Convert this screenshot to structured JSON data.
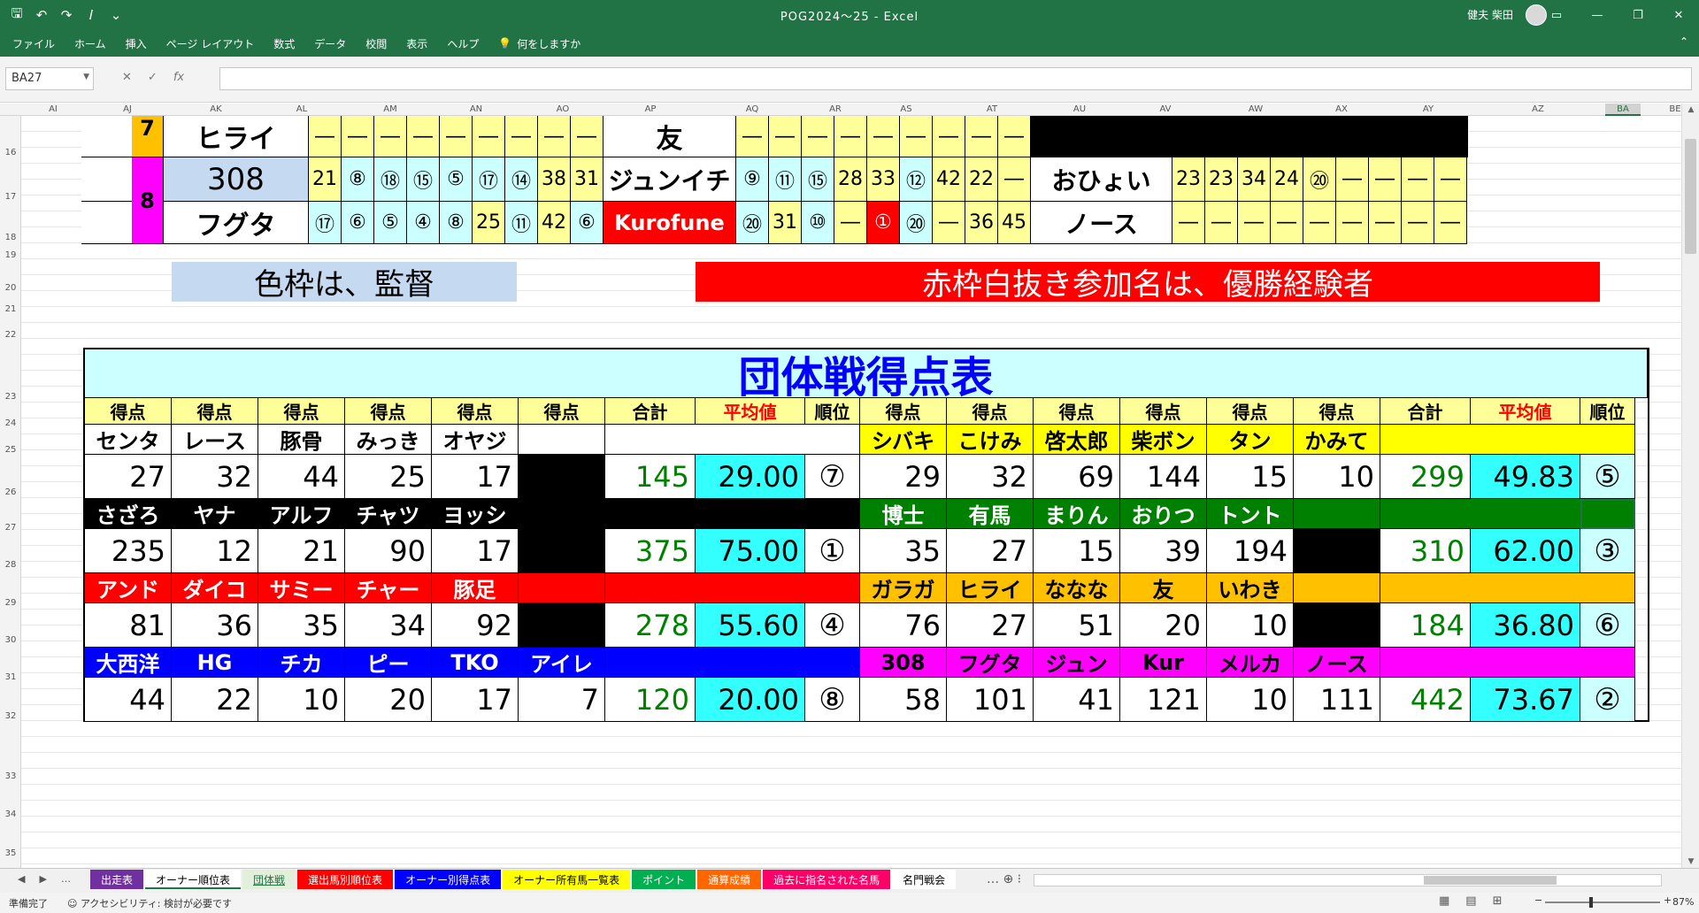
{
  "window": {
    "title": "POG2024～25 - Excel",
    "user": "健夫 柴田",
    "name_box": "BA27"
  },
  "ribbon_tabs": [
    "ファイル",
    "ホーム",
    "挿入",
    "ページ レイアウト",
    "数式",
    "データ",
    "校閲",
    "表示",
    "ヘルプ"
  ],
  "tell_me": "何をしますか",
  "columns": [
    "AI",
    "AJ",
    "AK",
    "AL",
    "AM",
    "AN",
    "AO",
    "AP",
    "AQ",
    "AR",
    "AS",
    "AT",
    "AU",
    "AV",
    "AW",
    "AX",
    "AY",
    "AZ",
    "BA",
    "BE"
  ],
  "rows": [
    "16",
    "17",
    "18",
    "19",
    "20",
    "21",
    "22",
    "23",
    "24",
    "25",
    "26",
    "27",
    "28",
    "29",
    "30",
    "31",
    "32",
    "33",
    "34",
    "35"
  ],
  "top_block": {
    "row16": {
      "group": "7",
      "owner1": "ヒライ",
      "owner1_scores": [
        "―",
        "―",
        "―",
        "―",
        "―",
        "―",
        "―",
        "―",
        "―"
      ],
      "owner2": "友",
      "owner2_scores": [
        "―",
        "―",
        "―",
        "―",
        "―",
        "―",
        "―",
        "―",
        "―"
      ]
    },
    "row17": {
      "group": "8",
      "owner1": "308",
      "owner1_scores": [
        "21",
        "⑧",
        "⑱",
        "⑮",
        "⑤",
        "⑰",
        "⑭",
        "38",
        "31"
      ],
      "owner2": "ジュンイチ",
      "owner2_scores": [
        "⑨",
        "⑪",
        "⑮",
        "28",
        "33",
        "⑫",
        "42",
        "22",
        "―"
      ],
      "owner3": "おひょい",
      "owner3_scores": [
        "23",
        "23",
        "34",
        "24",
        "⑳",
        "―",
        "―",
        "―",
        "―"
      ]
    },
    "row18": {
      "owner1": "フグタ",
      "owner1_scores": [
        "⑰",
        "⑥",
        "⑤",
        "④",
        "⑧",
        "25",
        "⑪",
        "42",
        "⑥"
      ],
      "owner2": "Kurofune",
      "owner2_scores": [
        "⑳",
        "31",
        "⑩",
        "―",
        "①",
        "⑳",
        "―",
        "36",
        "45"
      ],
      "owner3": "ノース",
      "owner3_scores": [
        "―",
        "―",
        "―",
        "―",
        "―",
        "―",
        "―",
        "―",
        "―"
      ]
    }
  },
  "notes": {
    "left": "色枠は、監督",
    "right": "赤枠白抜き参加名は、優勝経験者"
  },
  "team_table": {
    "title": "団体戦得点表",
    "header": {
      "score": "得点",
      "total": "合計",
      "average": "平均値",
      "rank": "順位"
    },
    "teams": [
      {
        "left": {
          "names": [
            "センタ",
            "レース",
            "豚骨",
            "みっき",
            "オヤジ",
            ""
          ],
          "scores": [
            "27",
            "32",
            "44",
            "25",
            "17",
            ""
          ],
          "total": "145",
          "avg": "29.00",
          "rank": "⑦"
        },
        "right": {
          "names": [
            "シバキ",
            "こけみ",
            "啓太郎",
            "柴ボン",
            "タン",
            "かみて"
          ],
          "scores": [
            "29",
            "32",
            "69",
            "144",
            "15",
            "10"
          ],
          "total": "299",
          "avg": "49.83",
          "rank": "⑤"
        }
      },
      {
        "left": {
          "names": [
            "さざろ",
            "ヤナ",
            "アルフ",
            "チャツ",
            "ヨッシ",
            ""
          ],
          "scores": [
            "235",
            "12",
            "21",
            "90",
            "17",
            ""
          ],
          "total": "375",
          "avg": "75.00",
          "rank": "①"
        },
        "right": {
          "names": [
            "博士",
            "有馬",
            "まりん",
            "おりつ",
            "トント",
            ""
          ],
          "scores": [
            "35",
            "27",
            "15",
            "39",
            "194",
            ""
          ],
          "total": "310",
          "avg": "62.00",
          "rank": "③"
        }
      },
      {
        "left": {
          "names": [
            "アンド",
            "ダイコ",
            "サミー",
            "チャー",
            "豚足",
            ""
          ],
          "scores": [
            "81",
            "36",
            "35",
            "34",
            "92",
            ""
          ],
          "total": "278",
          "avg": "55.60",
          "rank": "④"
        },
        "right": {
          "names": [
            "ガラガ",
            "ヒライ",
            "ななな",
            "友",
            "いわき",
            ""
          ],
          "scores": [
            "76",
            "27",
            "51",
            "20",
            "10",
            ""
          ],
          "total": "184",
          "avg": "36.80",
          "rank": "⑥"
        }
      },
      {
        "left": {
          "names": [
            "大西洋",
            "HG",
            "チカ",
            "ピー",
            "TKO",
            "アイレ"
          ],
          "scores": [
            "44",
            "22",
            "10",
            "20",
            "17",
            "7"
          ],
          "total": "120",
          "avg": "20.00",
          "rank": "⑧"
        },
        "right": {
          "names": [
            "308",
            "フグタ",
            "ジュン",
            "Kur",
            "メルカ",
            "ノース"
          ],
          "scores": [
            "58",
            "101",
            "41",
            "121",
            "10",
            "111"
          ],
          "total": "442",
          "avg": "73.67",
          "rank": "②"
        }
      }
    ]
  },
  "sheet_tabs": [
    {
      "label": "出走表",
      "color": "#7030a0"
    },
    {
      "label": "オーナー順位表",
      "color": "#ffffff",
      "active": true
    },
    {
      "label": "団体戦",
      "color": "#00b050"
    },
    {
      "label": "選出馬別順位表",
      "color": "#ff0000"
    },
    {
      "label": "オーナー別得点表",
      "color": "#0000ff"
    },
    {
      "label": "オーナー所有馬一覧表",
      "color": "#ffff00"
    },
    {
      "label": "ポイント",
      "color": "#00b050"
    },
    {
      "label": "通算成績",
      "color": "#ff6600"
    },
    {
      "label": "過去に指名された名馬",
      "color": "#ff0066"
    },
    {
      "label": "名門戦会",
      "color": "#ffffff"
    }
  ],
  "status": {
    "ready": "準備完了",
    "accessibility": "アクセシビリティ: 検討が必要です",
    "zoom": "87%"
  },
  "colors": {
    "excel_green": "#217346",
    "pale_yellow": "#ffff99",
    "pale_cyan": "#ccffff",
    "pale_blue": "#c5d9f1",
    "magenta": "#ff00ff",
    "orange": "#ffc000",
    "dark_green": "#008000",
    "red": "#ff0000",
    "blue": "#0000ff",
    "cyan": "#33ffff"
  }
}
